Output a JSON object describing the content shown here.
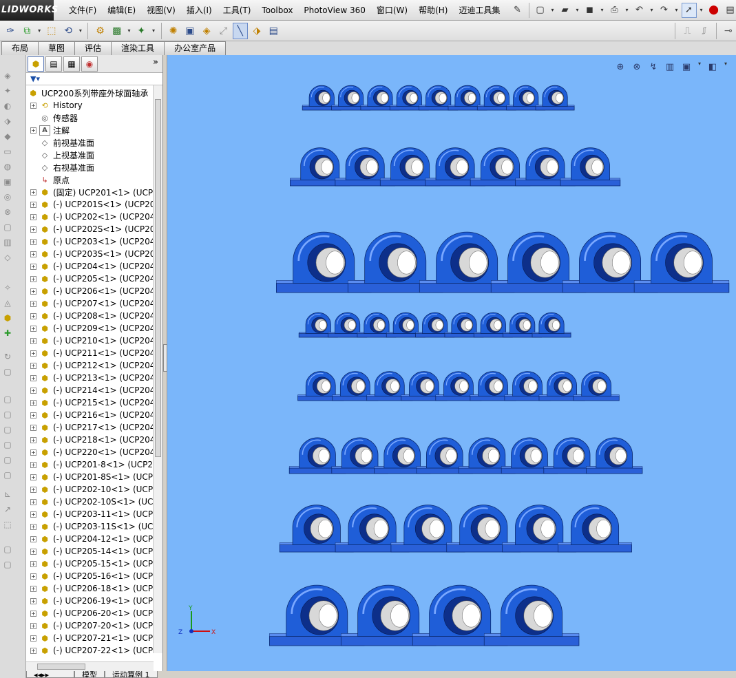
{
  "app": {
    "logo": "LIDWORKS"
  },
  "menu": {
    "items": [
      "文件(F)",
      "编辑(E)",
      "视图(V)",
      "插入(I)",
      "工具(T)",
      "Toolbox",
      "PhotoView 360",
      "窗口(W)",
      "帮助(H)",
      "迈迪工具集"
    ]
  },
  "command_tabs": [
    "布局",
    "草图",
    "评估",
    "渲染工具",
    "办公室产品"
  ],
  "tree": {
    "root": "UCP200系列带座外球面轴承",
    "nodes": [
      {
        "label": "History",
        "icon": "history-icon",
        "expand": true
      },
      {
        "label": "传感器",
        "icon": "sensor-icon",
        "expand": false
      },
      {
        "label": "注解",
        "icon": "annotation-icon",
        "expand": true
      },
      {
        "label": "前视基准面",
        "icon": "plane-icon",
        "expand": false
      },
      {
        "label": "上视基准面",
        "icon": "plane-icon",
        "expand": false
      },
      {
        "label": "右视基准面",
        "icon": "plane-icon",
        "expand": false
      },
      {
        "label": "原点",
        "icon": "origin-icon",
        "expand": false
      },
      {
        "label": "(固定) UCP201<1> (UCP2",
        "icon": "part-icon",
        "expand": true
      },
      {
        "label": "(-) UCP201S<1> (UCP20",
        "icon": "part-icon",
        "expand": true
      },
      {
        "label": "(-) UCP202<1> (UCP204",
        "icon": "part-icon",
        "expand": true
      },
      {
        "label": "(-) UCP202S<1> (UCP20",
        "icon": "part-icon",
        "expand": true
      },
      {
        "label": "(-) UCP203<1> (UCP204",
        "icon": "part-icon",
        "expand": true
      },
      {
        "label": "(-) UCP203S<1> (UCP20",
        "icon": "part-icon",
        "expand": true
      },
      {
        "label": "(-) UCP204<1> (UCP204",
        "icon": "part-icon",
        "expand": true
      },
      {
        "label": "(-) UCP205<1> (UCP204",
        "icon": "part-icon",
        "expand": true
      },
      {
        "label": "(-) UCP206<1> (UCP204",
        "icon": "part-icon",
        "expand": true
      },
      {
        "label": "(-) UCP207<1> (UCP204",
        "icon": "part-icon",
        "expand": true
      },
      {
        "label": "(-) UCP208<1> (UCP204",
        "icon": "part-icon",
        "expand": true
      },
      {
        "label": "(-) UCP209<1> (UCP204",
        "icon": "part-icon",
        "expand": true
      },
      {
        "label": "(-) UCP210<1> (UCP204",
        "icon": "part-icon",
        "expand": true
      },
      {
        "label": "(-) UCP211<1> (UCP204",
        "icon": "part-icon",
        "expand": true
      },
      {
        "label": "(-) UCP212<1> (UCP204",
        "icon": "part-icon",
        "expand": true
      },
      {
        "label": "(-) UCP213<1> (UCP204",
        "icon": "part-icon",
        "expand": true
      },
      {
        "label": "(-) UCP214<1> (UCP204",
        "icon": "part-icon",
        "expand": true
      },
      {
        "label": "(-) UCP215<1> (UCP204",
        "icon": "part-icon",
        "expand": true
      },
      {
        "label": "(-) UCP216<1> (UCP204",
        "icon": "part-icon",
        "expand": true
      },
      {
        "label": "(-) UCP217<1> (UCP204",
        "icon": "part-icon",
        "expand": true
      },
      {
        "label": "(-) UCP218<1> (UCP204",
        "icon": "part-icon",
        "expand": true
      },
      {
        "label": "(-) UCP220<1> (UCP204",
        "icon": "part-icon",
        "expand": true
      },
      {
        "label": "(-) UCP201-8<1> (UCP2",
        "icon": "part-icon",
        "expand": true
      },
      {
        "label": "(-) UCP201-8S<1> (UCP2",
        "icon": "part-icon",
        "expand": true
      },
      {
        "label": "(-) UCP202-10<1> (UCP2",
        "icon": "part-icon",
        "expand": true
      },
      {
        "label": "(-) UCP202-10S<1> (UCI",
        "icon": "part-icon",
        "expand": true
      },
      {
        "label": "(-) UCP203-11<1> (UCP2",
        "icon": "part-icon",
        "expand": true
      },
      {
        "label": "(-) UCP203-11S<1> (UCI",
        "icon": "part-icon",
        "expand": true
      },
      {
        "label": "(-) UCP204-12<1> (UCP2",
        "icon": "part-icon",
        "expand": true
      },
      {
        "label": "(-) UCP205-14<1> (UCP2",
        "icon": "part-icon",
        "expand": true
      },
      {
        "label": "(-) UCP205-15<1> (UCP2",
        "icon": "part-icon",
        "expand": true
      },
      {
        "label": "(-) UCP205-16<1> (UCP2",
        "icon": "part-icon",
        "expand": true
      },
      {
        "label": "(-) UCP206-18<1> (UCP2",
        "icon": "part-icon",
        "expand": true
      },
      {
        "label": "(-) UCP206-19<1> (UCP2",
        "icon": "part-icon",
        "expand": true
      },
      {
        "label": "(-) UCP206-20<1> (UCP2",
        "icon": "part-icon",
        "expand": true
      },
      {
        "label": "(-) UCP207-20<1> (UCP2",
        "icon": "part-icon",
        "expand": true
      },
      {
        "label": "(-) UCP207-21<1> (UCP2",
        "icon": "part-icon",
        "expand": true
      },
      {
        "label": "(-) UCP207-22<1> (UCP2",
        "icon": "part-icon",
        "expand": true
      }
    ]
  },
  "bottom_tabs": [
    "模型",
    "运动算例 1"
  ],
  "triad": {
    "x": "X",
    "y": "Y",
    "z": "Z"
  },
  "colors": {
    "viewport_bg": "#7ab6fa",
    "housing_blue": "#1f5ed8",
    "bearing_silver": "#d8d8d8"
  },
  "viewport": {
    "bearing_rows": [
      {
        "count": 9,
        "scale": 0.55,
        "gap": 1.0
      },
      {
        "count": 7,
        "scale": 0.85,
        "gap": 1.0
      },
      {
        "count": 6,
        "scale": 1.35,
        "gap": 1.0
      },
      {
        "count": 9,
        "scale": 0.55,
        "gap": 1.0
      },
      {
        "count": 9,
        "scale": 0.65,
        "gap": 1.0
      },
      {
        "count": 8,
        "scale": 0.8,
        "gap": 1.0
      },
      {
        "count": 6,
        "scale": 1.05,
        "gap": 1.0
      },
      {
        "count": 4,
        "scale": 1.35,
        "gap": 1.0
      }
    ]
  }
}
